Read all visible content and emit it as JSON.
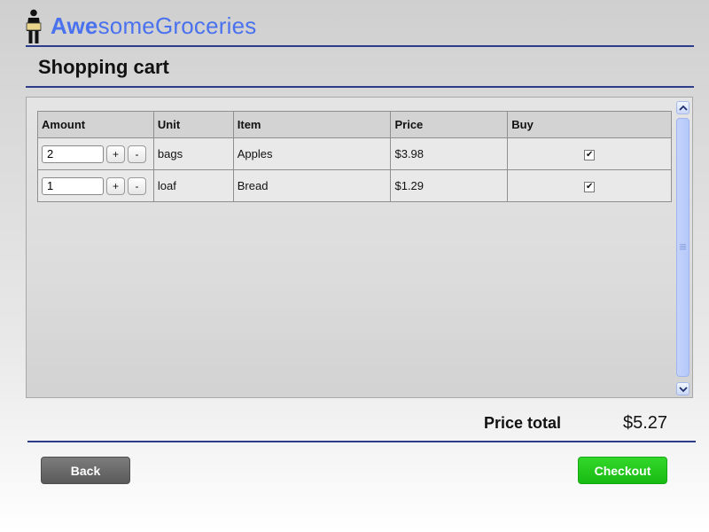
{
  "header": {
    "brand_part1": "Awe",
    "brand_part2": "someGroceries",
    "brand_color": "#4a72ee"
  },
  "page": {
    "title": "Shopping cart"
  },
  "cart": {
    "columns": [
      "Amount",
      "Unit",
      "Item",
      "Price",
      "Buy"
    ],
    "rows": [
      {
        "amount": "2",
        "unit": "bags",
        "item": "Apples",
        "price": "$3.98",
        "buy": true
      },
      {
        "amount": "1",
        "unit": "loaf",
        "item": "Bread",
        "price": "$1.29",
        "buy": true
      }
    ],
    "increment_label": "+",
    "decrement_label": "-"
  },
  "total": {
    "label": "Price total",
    "value": "$5.27"
  },
  "actions": {
    "back_label": "Back",
    "checkout_label": "Checkout",
    "checkout_color": "#1dc416"
  },
  "icons": {
    "logo": "grocery-person-icon",
    "scroll_up": "chevron-up-icon",
    "scroll_down": "chevron-down-icon",
    "grip": "scroll-grip-icon",
    "check": "checkmark-icon"
  }
}
